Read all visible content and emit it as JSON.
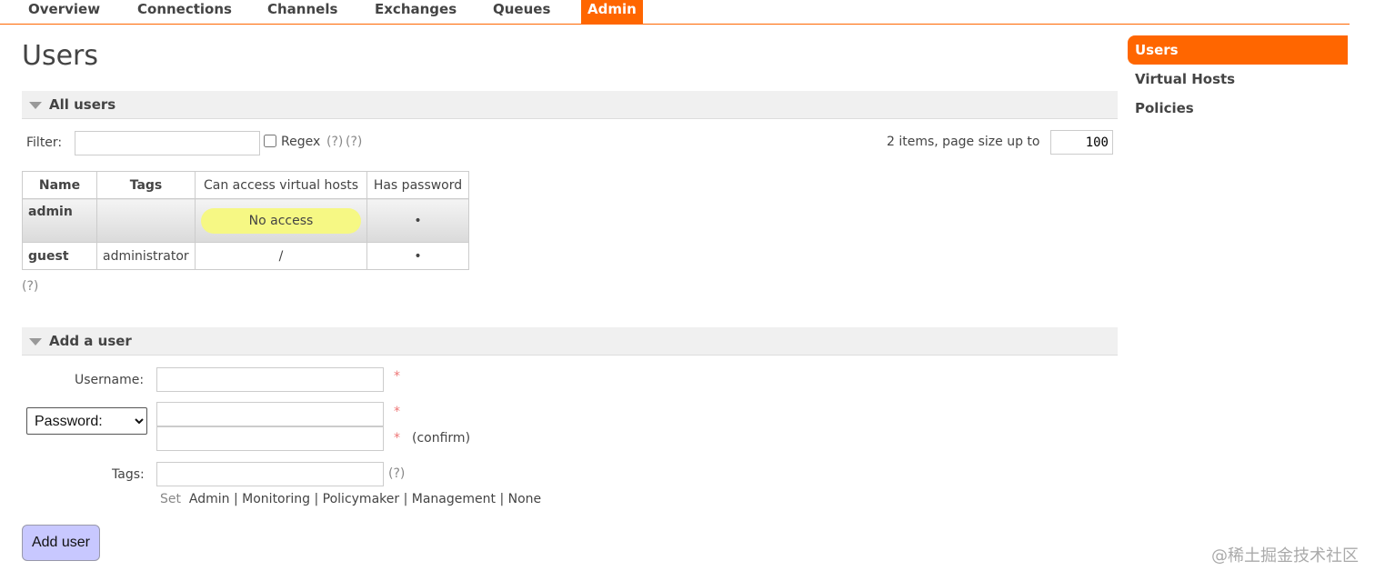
{
  "nav": {
    "items": [
      {
        "label": "Overview"
      },
      {
        "label": "Connections"
      },
      {
        "label": "Channels"
      },
      {
        "label": "Exchanges"
      },
      {
        "label": "Queues"
      },
      {
        "label": "Admin",
        "active": true
      }
    ]
  },
  "sidebar": {
    "items": [
      {
        "label": "Users",
        "active": true
      },
      {
        "label": "Virtual Hosts"
      },
      {
        "label": "Policies"
      }
    ]
  },
  "page": {
    "title": "Users"
  },
  "all_users": {
    "section_title": "All users",
    "filter_label": "Filter:",
    "filter_value": "",
    "regex_label": "Regex",
    "regex_checked": false,
    "help1": "(?)",
    "help2": "(?)",
    "items_text": "2 items, page size up to",
    "page_size": "100",
    "columns": [
      "Name",
      "Tags",
      "Can access virtual hosts",
      "Has password"
    ],
    "rows": [
      {
        "name": "admin",
        "tags": "",
        "vhosts": "No access",
        "has_password": "•"
      },
      {
        "name": "guest",
        "tags": "administrator",
        "vhosts": "/",
        "has_password": "•"
      }
    ],
    "table_help": "(?)"
  },
  "add_user": {
    "section_title": "Add a user",
    "username_label": "Username:",
    "username_value": "",
    "password_select": "Password:",
    "required_mark": "*",
    "confirm_label": "(confirm)",
    "tags_label": "Tags:",
    "tags_value": "",
    "tags_help": "(?)",
    "set_label": "Set",
    "tag_options": [
      "Admin",
      "Monitoring",
      "Policymaker",
      "Management",
      "None"
    ],
    "separator": "|",
    "submit_label": "Add user"
  },
  "watermark": {
    "text": "@稀土掘金技术社区"
  },
  "colors": {
    "accent": "#ff6600",
    "pill": "#f6f884",
    "button": "#c8c8ff"
  }
}
